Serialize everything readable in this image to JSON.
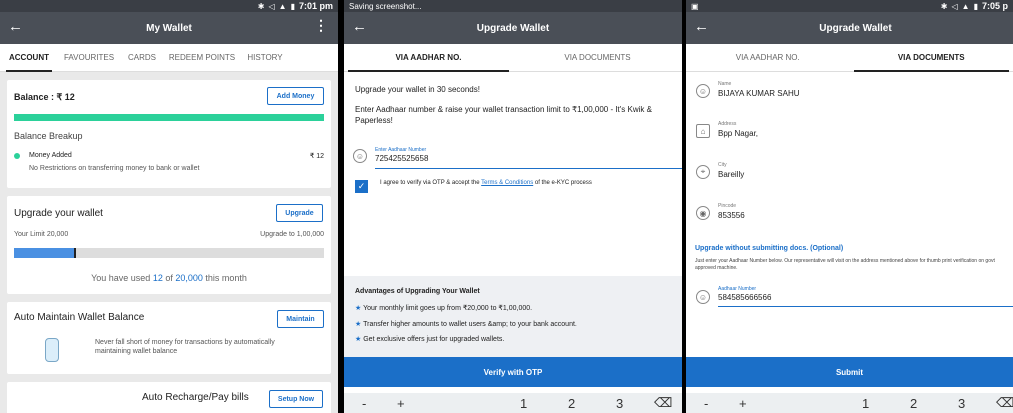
{
  "panel1": {
    "status": {
      "time": "7:01 pm"
    },
    "appbar": {
      "title": "My Wallet"
    },
    "tabs": [
      "ACCOUNT",
      "FAVOURITES",
      "CARDS",
      "REDEEM POINTS",
      "HISTORY"
    ],
    "balance": {
      "label": "Balance : ₹ 12",
      "add_money": "Add Money",
      "breakup_title": "Balance Breakup",
      "money_added_label": "Money Added",
      "money_added_value": "₹ 12",
      "note": "No Restrictions on transferring money to bank or wallet",
      "accent": "#2bd19a"
    },
    "upgrade": {
      "title": "Upgrade your wallet",
      "button": "Upgrade",
      "limit_left": "Your Limit 20,000",
      "limit_right": "Upgrade to 1,00,000",
      "used_fraction": 0.2,
      "used_prefix": "You have used ",
      "used_amount": "12",
      "used_of": " of ",
      "used_total": "20,000",
      "used_suffix": " this month"
    },
    "auto_maintain": {
      "title": "Auto Maintain Wallet Balance",
      "button": "Maintain",
      "desc": "Never fall short of money for transactions by automatically maintaining wallet balance",
      "icon": "bottle-icon"
    },
    "auto_recharge": {
      "title": "Auto Recharge/Pay bills",
      "button": "Setup Now"
    }
  },
  "panel2": {
    "status": {
      "notification": "Saving screenshot..."
    },
    "appbar": {
      "title": "Upgrade Wallet"
    },
    "tabs": [
      "VIA AADHAR NO.",
      "VIA DOCUMENTS"
    ],
    "intro1": "Upgrade your wallet in 30 seconds!",
    "intro2": "Enter Aadhaar number & raise your wallet transaction limit to ₹1,00,000 - It's Kwik & Paperless!",
    "field_label": "Enter Aadhaar Number",
    "field_value": "725425525658",
    "consent_prefix": "I agree to verify via OTP & accept the ",
    "consent_link": "Terms & Conditions",
    "consent_suffix": " of the e-KYC process",
    "advantages_title": "Advantages of Upgrading Your Wallet",
    "advantages": [
      "Your monthly limit goes up from ₹20,000 to ₹1,00,000.",
      "Transfer higher amounts to wallet users &amp; to your bank account.",
      "Get exclusive offers just for upgraded wallets."
    ],
    "verify_button": "Verify with OTP",
    "keyboard": [
      "-",
      "+",
      "1",
      "2",
      "3",
      "⌫"
    ],
    "accent": "#1b6fc8"
  },
  "panel3": {
    "status": {
      "time": "7:05 p"
    },
    "appbar": {
      "title": "Upgrade Wallet"
    },
    "tabs": [
      "VIA AADHAR NO.",
      "VIA DOCUMENTS"
    ],
    "fields": [
      {
        "label": "Name",
        "value": "BIJAYA KUMAR SAHU",
        "icon": "person-icon"
      },
      {
        "label": "Address",
        "value": "Bpp Nagar,",
        "icon": "house-icon"
      },
      {
        "label": "City",
        "value": "Bareilly",
        "icon": "location-icon"
      },
      {
        "label": "Pincode",
        "value": "853556",
        "icon": "pin-icon"
      }
    ],
    "upgrade_title": "Upgrade without submitting docs. (Optional)",
    "upgrade_desc": "Just enter your Aadhaar Number below. Our representative will visit on the address mentioned above for thumb print verification on govt approved machine.",
    "aadhaar_label": "Aadhaar Number",
    "aadhaar_value": "584585666566",
    "submit_button": "Submit",
    "keyboard": [
      "-",
      "+",
      "1",
      "2",
      "3",
      "⌫"
    ]
  }
}
